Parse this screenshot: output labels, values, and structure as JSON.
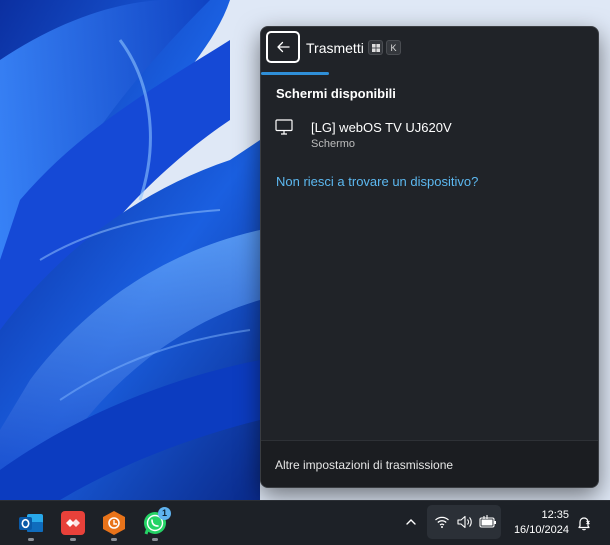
{
  "panel": {
    "title": "Trasmetti",
    "shortcut_keys": [
      "⊞",
      "K"
    ],
    "section_title": "Schermi disponibili",
    "devices": [
      {
        "name": "[LG] webOS TV UJ620V",
        "type": "Schermo",
        "icon": "monitor-icon"
      }
    ],
    "help_link": "Non riesci a trovare un dispositivo?",
    "footer_link": "Altre impostazioni di trasmissione"
  },
  "taskbar": {
    "apps": [
      {
        "name": "outlook",
        "icon": "outlook-icon",
        "color": "#0f6cbd"
      },
      {
        "name": "anydesk",
        "icon": "anydesk-icon",
        "color": "#e8413a"
      },
      {
        "name": "hexagon-app",
        "icon": "hexagon-app-icon",
        "color": "#e8731a"
      },
      {
        "name": "whatsapp",
        "icon": "whatsapp-icon",
        "color": "#25d366",
        "badge": "1"
      }
    ],
    "tray_icons": [
      "chevron-up-icon",
      "wifi-icon",
      "volume-icon",
      "battery-icon"
    ],
    "time": "12:35",
    "date": "16/10/2024",
    "notification_icon": "bell-icon"
  },
  "colors": {
    "accent": "#2f8fd8",
    "link": "#5cb8f0",
    "panel_bg": "#202328",
    "taskbar_bg": "#1d2127"
  }
}
